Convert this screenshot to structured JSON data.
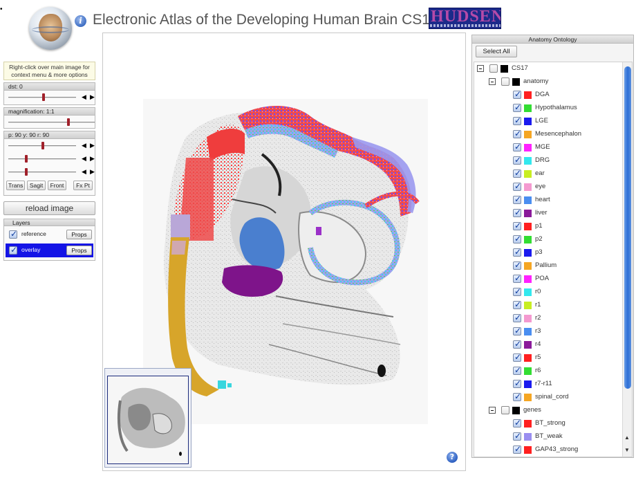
{
  "header": {
    "title": "Electronic Atlas of the Developing Human Brain CS17",
    "logo_text": "HUDSEN",
    "logo_subtitle": "Electronic Atlas of the Developing Human Brain",
    "info_glyph": "i",
    "corner_mark": "•"
  },
  "hint": "Right-click over main image for context menu & more options",
  "controls": {
    "dst_label": "dst: 0",
    "dst_value": 0,
    "magnification_label": "magnification: 1:1",
    "angles_label": "p: 90   y: 90   r: 90",
    "pitch": 90,
    "yaw": 90,
    "roll": 90,
    "arrow_left": "◀",
    "arrow_right": "▶",
    "view_buttons": {
      "trans": "Trans",
      "sagit": "Sagit",
      "front": "Front",
      "fxpt": "Fx Pt"
    },
    "reload": "reload image"
  },
  "layers": {
    "title": "Layers",
    "items": [
      {
        "name": "reference",
        "checked": true,
        "props": "Props",
        "active": false
      },
      {
        "name": "overlay",
        "checked": true,
        "props": "Props",
        "active": true
      }
    ]
  },
  "viewer": {
    "help_glyph": "?"
  },
  "ontology": {
    "title": "Anatomy Ontology",
    "select_all": "Select All",
    "rows": [
      {
        "label": "CS17",
        "level": 0,
        "toggle": true,
        "checked": false,
        "color": "#000000"
      },
      {
        "label": "anatomy",
        "level": 1,
        "toggle": true,
        "checked": false,
        "color": "#000000"
      },
      {
        "label": "DGA",
        "level": 2,
        "checked": true,
        "color": "#ff2020"
      },
      {
        "label": "Hypothalamus",
        "level": 2,
        "checked": true,
        "color": "#33dd33"
      },
      {
        "label": "LGE",
        "level": 2,
        "checked": true,
        "color": "#1a1aee"
      },
      {
        "label": "Mesencephalon",
        "level": 2,
        "checked": true,
        "color": "#f5a623"
      },
      {
        "label": "MGE",
        "level": 2,
        "checked": true,
        "color": "#ff22ff"
      },
      {
        "label": "DRG",
        "level": 2,
        "checked": true,
        "color": "#33e8ee"
      },
      {
        "label": "ear",
        "level": 2,
        "checked": true,
        "color": "#c8ee22"
      },
      {
        "label": "eye",
        "level": 2,
        "checked": true,
        "color": "#f49ad0"
      },
      {
        "label": "heart",
        "level": 2,
        "checked": true,
        "color": "#4a8ef0"
      },
      {
        "label": "liver",
        "level": 2,
        "checked": true,
        "color": "#8a1a9a"
      },
      {
        "label": "p1",
        "level": 2,
        "checked": true,
        "color": "#ff2020"
      },
      {
        "label": "p2",
        "level": 2,
        "checked": true,
        "color": "#33dd33"
      },
      {
        "label": "p3",
        "level": 2,
        "checked": true,
        "color": "#1a1aee"
      },
      {
        "label": "Pallium",
        "level": 2,
        "checked": true,
        "color": "#f5a623"
      },
      {
        "label": "POA",
        "level": 2,
        "checked": true,
        "color": "#ff22ff"
      },
      {
        "label": "r0",
        "level": 2,
        "checked": true,
        "color": "#33e8ee"
      },
      {
        "label": "r1",
        "level": 2,
        "checked": true,
        "color": "#c8ee22"
      },
      {
        "label": "r2",
        "level": 2,
        "checked": true,
        "color": "#f49ad0"
      },
      {
        "label": "r3",
        "level": 2,
        "checked": true,
        "color": "#4a8ef0"
      },
      {
        "label": "r4",
        "level": 2,
        "checked": true,
        "color": "#8a1a9a"
      },
      {
        "label": "r5",
        "level": 2,
        "checked": true,
        "color": "#ff2020"
      },
      {
        "label": "r6",
        "level": 2,
        "checked": true,
        "color": "#33dd33"
      },
      {
        "label": "r7-r11",
        "level": 2,
        "checked": true,
        "color": "#1a1aee"
      },
      {
        "label": "spinal_cord",
        "level": 2,
        "checked": true,
        "color": "#f5a623"
      },
      {
        "label": "genes",
        "level": 1,
        "toggle": true,
        "checked": false,
        "color": "#000000"
      },
      {
        "label": "BT_strong",
        "level": 2,
        "checked": true,
        "color": "#ff2020"
      },
      {
        "label": "BT_weak",
        "level": 2,
        "checked": true,
        "color": "#9a8ef0"
      },
      {
        "label": "GAP43_strong",
        "level": 2,
        "checked": true,
        "color": "#ff2020"
      }
    ],
    "scroll_up": "▲",
    "scroll_down": "▼"
  }
}
